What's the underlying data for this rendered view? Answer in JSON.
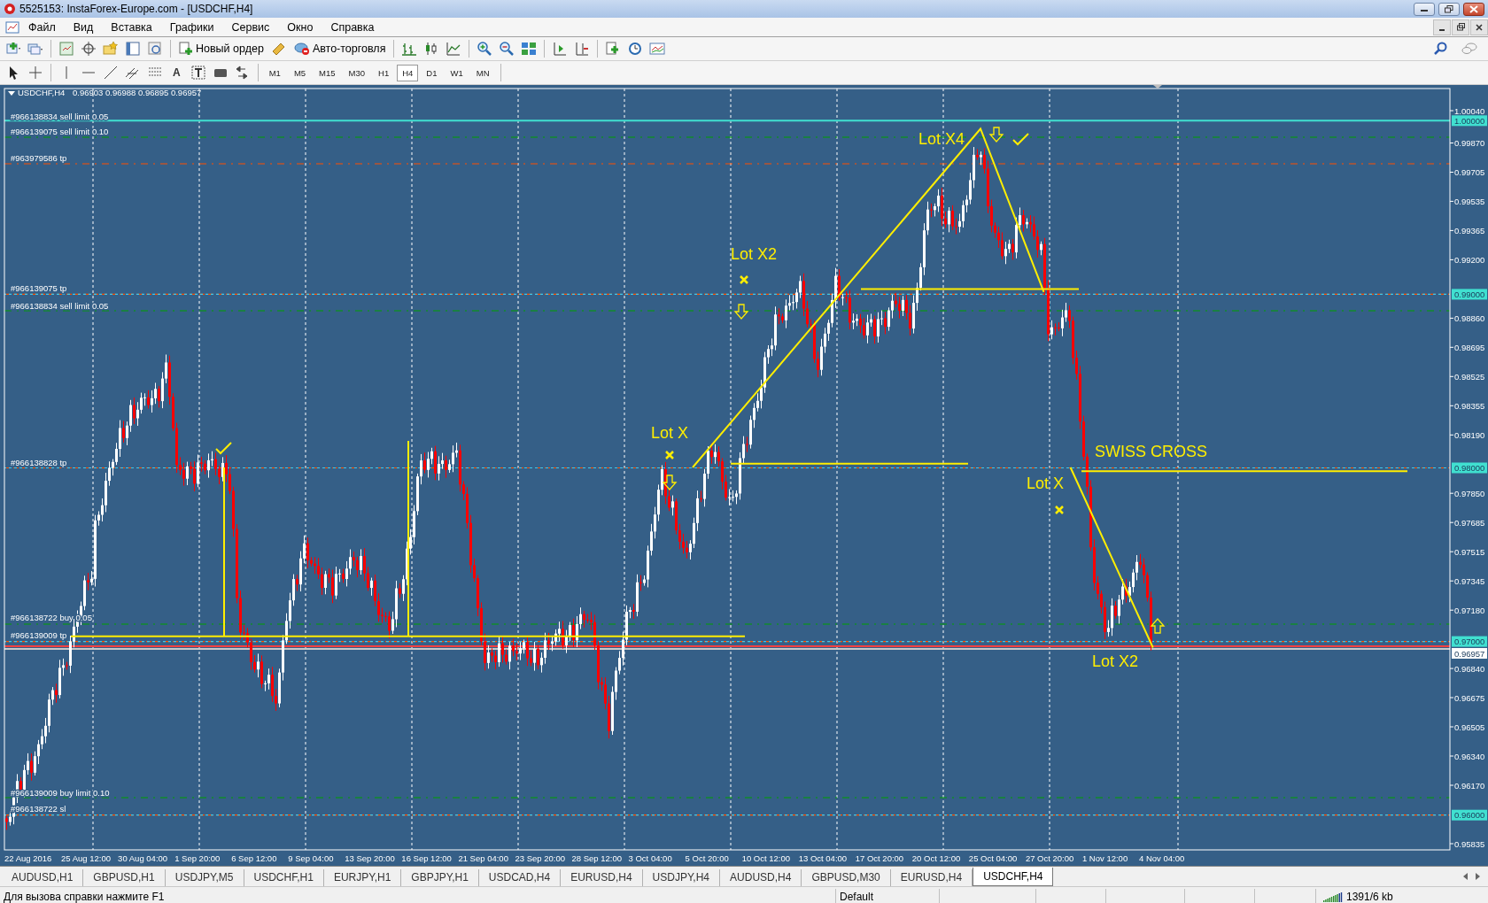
{
  "window": {
    "title": "5525153: InstaForex-Europe.com - [USDCHF,H4]"
  },
  "menu": [
    "Файл",
    "Вид",
    "Вставка",
    "Графики",
    "Сервис",
    "Окно",
    "Справка"
  ],
  "toolbar": {
    "new_order": "Новый ордер",
    "auto_trading": "Авто-торговля"
  },
  "drawing_toolbar": {
    "text_tool": "A"
  },
  "timeframes": [
    {
      "label": "M1",
      "selected": false
    },
    {
      "label": "M5",
      "selected": false
    },
    {
      "label": "M15",
      "selected": false
    },
    {
      "label": "M30",
      "selected": false
    },
    {
      "label": "H1",
      "selected": false
    },
    {
      "label": "H4",
      "selected": true
    },
    {
      "label": "D1",
      "selected": false
    },
    {
      "label": "W1",
      "selected": false
    },
    {
      "label": "MN",
      "selected": false
    }
  ],
  "chart": {
    "symbol": "USDCHF,H4",
    "ohlc": "0.96903 0.96988 0.96895 0.96957",
    "orders": [
      "#966138834 sell limit 0.05",
      "#966139075 sell limit 0.10",
      "#963979586 tp",
      "#966139075 tp",
      "#966138834 sell limit 0.05",
      "#966138828 tp",
      "#966138722 buy 0.05",
      "#966139009 tp",
      "#966139009 buy limit 0.10",
      "#966138722 sl"
    ],
    "annotations": [
      "Lot X4",
      "Lot X2",
      "Lot X",
      "SWISS CROSS",
      "Lot X",
      "Lot X2"
    ],
    "price_axis": [
      {
        "label": "1.00040",
        "kind": "tick"
      },
      {
        "label": "1.00000",
        "kind": "order"
      },
      {
        "label": "0.99870",
        "kind": "tick"
      },
      {
        "label": "0.99705",
        "kind": "tick"
      },
      {
        "label": "0.99535",
        "kind": "tick"
      },
      {
        "label": "0.99365",
        "kind": "tick"
      },
      {
        "label": "0.99200",
        "kind": "tick"
      },
      {
        "label": "0.99000",
        "kind": "order"
      },
      {
        "label": "0.98860",
        "kind": "tick"
      },
      {
        "label": "0.98695",
        "kind": "tick"
      },
      {
        "label": "0.98525",
        "kind": "tick"
      },
      {
        "label": "0.98355",
        "kind": "tick"
      },
      {
        "label": "0.98190",
        "kind": "tick"
      },
      {
        "label": "0.98000",
        "kind": "order"
      },
      {
        "label": "0.97850",
        "kind": "tick"
      },
      {
        "label": "0.97685",
        "kind": "tick"
      },
      {
        "label": "0.97515",
        "kind": "tick"
      },
      {
        "label": "0.97345",
        "kind": "tick"
      },
      {
        "label": "0.97180",
        "kind": "tick"
      },
      {
        "label": "0.97000",
        "kind": "order"
      },
      {
        "label": "0.96957",
        "kind": "bid"
      },
      {
        "label": "0.96840",
        "kind": "tick"
      },
      {
        "label": "0.96675",
        "kind": "tick"
      },
      {
        "label": "0.96505",
        "kind": "tick"
      },
      {
        "label": "0.96340",
        "kind": "tick"
      },
      {
        "label": "0.96170",
        "kind": "tick"
      },
      {
        "label": "0.96000",
        "kind": "order"
      },
      {
        "label": "0.95835",
        "kind": "tick"
      }
    ],
    "time_axis": [
      "22 Aug 2016",
      "25 Aug 12:00",
      "30 Aug 04:00",
      "1 Sep 20:00",
      "6 Sep 12:00",
      "9 Sep 04:00",
      "13 Sep 20:00",
      "16 Sep 12:00",
      "21 Sep 04:00",
      "23 Sep 20:00",
      "28 Sep 12:00",
      "3 Oct 04:00",
      "5 Oct 20:00",
      "10 Oct 12:00",
      "13 Oct 04:00",
      "17 Oct 20:00",
      "20 Oct 12:00",
      "25 Oct 04:00",
      "27 Oct 20:00",
      "1 Nov 12:00",
      "4 Nov 04:00"
    ]
  },
  "tabs": [
    {
      "label": "AUDUSD,H1",
      "selected": false
    },
    {
      "label": "GBPUSD,H1",
      "selected": false
    },
    {
      "label": "USDJPY,M5",
      "selected": false
    },
    {
      "label": "USDCHF,H1",
      "selected": false
    },
    {
      "label": "EURJPY,H1",
      "selected": false
    },
    {
      "label": "GBPJPY,H1",
      "selected": false
    },
    {
      "label": "USDCAD,H4",
      "selected": false
    },
    {
      "label": "EURUSD,H4",
      "selected": false
    },
    {
      "label": "USDJPY,H4",
      "selected": false
    },
    {
      "label": "AUDUSD,H4",
      "selected": false
    },
    {
      "label": "GBPUSD,M30",
      "selected": false
    },
    {
      "label": "EURUSD,H4",
      "selected": false
    },
    {
      "label": "USDCHF,H4",
      "selected": true
    }
  ],
  "status_bar": {
    "help": "Для вызова справки нажмите F1",
    "profile": "Default",
    "traffic": "1391/6 kb"
  }
}
